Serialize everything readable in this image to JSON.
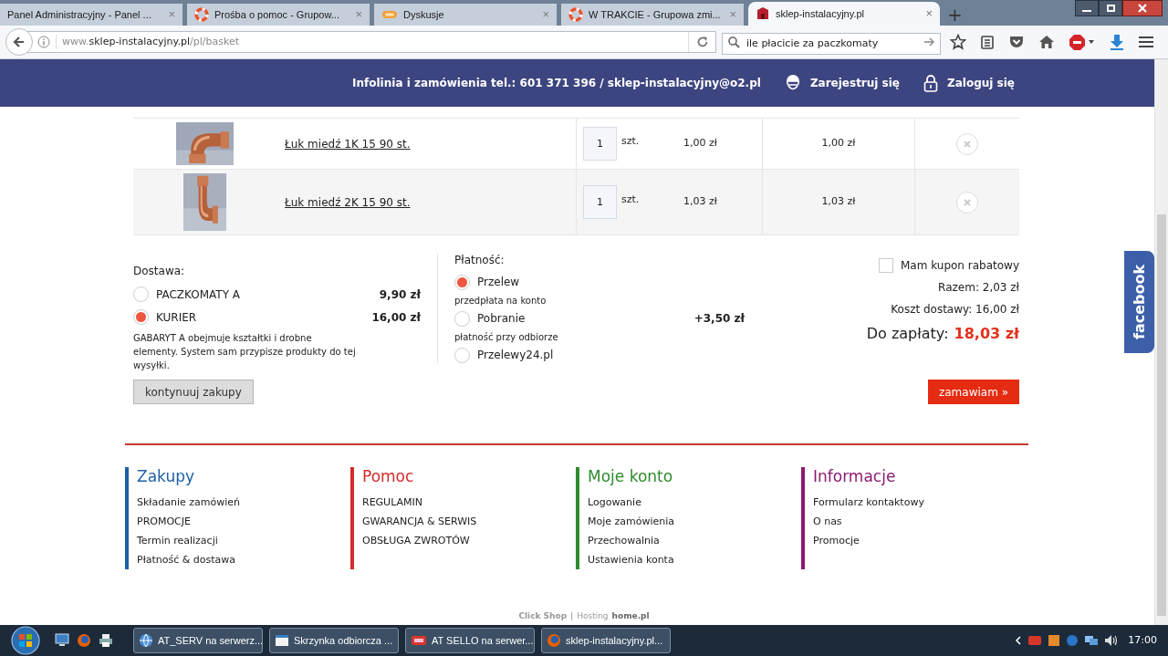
{
  "browser": {
    "tabs": [
      {
        "title": "Panel Administracyjny - Panel ...",
        "close": "×",
        "selected": false
      },
      {
        "title": "Prośba o pomoc - Grupow...",
        "close": "×",
        "selected": false
      },
      {
        "title": "Dyskusje",
        "close": "×",
        "selected": false
      },
      {
        "title": "W TRAKCIE - Grupowa zmi...",
        "close": "×",
        "selected": false
      },
      {
        "title": "sklep-instalacyjny.pl",
        "close": "×",
        "selected": true
      }
    ],
    "new_tab": "+",
    "url": {
      "prefix": "www.",
      "domain": "sklep-instalacyjny.pl",
      "path": "/pl/basket"
    },
    "search": {
      "value": "ile płacicie za paczkomaty"
    }
  },
  "header": {
    "info": "Infolinia i zamówienia tel.: 601 371 396 / sklep-instalacyjny@o2.pl",
    "register": "Zarejestruj się",
    "login": "Zaloguj się"
  },
  "cart": {
    "rows": [
      {
        "name": "Łuk miedź 1K 15 90 st.",
        "qty": "1",
        "unit": "szt.",
        "price": "1,00 zł",
        "total": "1,00 zł"
      },
      {
        "name": "Łuk miedź 2K 15 90 st.",
        "qty": "1",
        "unit": "szt.",
        "price": "1,03 zł",
        "total": "1,03 zł"
      }
    ]
  },
  "delivery": {
    "title": "Dostawa:",
    "options": [
      {
        "label": "PACZKOMATY A",
        "price": "9,90 zł",
        "selected": false
      },
      {
        "label": "KURIER",
        "price": "16,00 zł",
        "selected": true
      }
    ],
    "note": "GABARYT A obejmuje kształtki i drobne elementy. System sam przypisze produkty do tej wysyłki."
  },
  "payment": {
    "title": "Płatność:",
    "options": [
      {
        "label": "Przelew",
        "note": "przedpłata na konto",
        "selected": true
      },
      {
        "label": "Pobranie",
        "surcharge": "+3,50 zł",
        "note": "płatność przy odbiorze",
        "selected": false
      },
      {
        "label": "Przelewy24.pl",
        "selected": false
      }
    ]
  },
  "summary": {
    "coupon": {
      "label": "Mam kupon rabatowy",
      "checked": false
    },
    "subtotal": "Razem: 2,03 zł",
    "shipping": "Koszt dostawy: 16,00 zł",
    "total_label": "Do zapłaty:",
    "total": "18,03 zł"
  },
  "buttons": {
    "continue": "kontynuuj zakupy",
    "order": "zamawiam »"
  },
  "footer": {
    "columns": [
      {
        "title": "Zakupy",
        "color": "#1f5fa8",
        "links": [
          "Składanie zamówień",
          "PROMOCJE",
          "Termin realizacji",
          "Płatność & dostawa"
        ]
      },
      {
        "title": "Pomoc",
        "color": "#d42a2a",
        "links": [
          "REGULAMIN",
          "GWARANCJA & SERWIS",
          "OBSŁUGA ZWROTÓW"
        ]
      },
      {
        "title": "Moje konto",
        "color": "#2e8b2e",
        "links": [
          "Logowanie",
          "Moje zamówienia",
          "Przechowalnia",
          "Ustawienia konta"
        ]
      },
      {
        "title": "Informacje",
        "color": "#8b1a6e",
        "links": [
          "Formularz kontaktowy",
          "O nas",
          "Promocje"
        ]
      }
    ],
    "credits": {
      "brand": "Click Shop",
      "separator": "|",
      "hosting": "Hosting",
      "host": "home.pl"
    }
  },
  "facebook": "facebook",
  "taskbar": {
    "items": [
      {
        "label": "AT_SERV na serwerz..."
      },
      {
        "label": "Skrzynka odbiorcza ..."
      },
      {
        "label": "AT SELLO na serwer..."
      },
      {
        "label": "sklep-instalacyjny.pl..."
      }
    ],
    "clock": "17:00"
  }
}
